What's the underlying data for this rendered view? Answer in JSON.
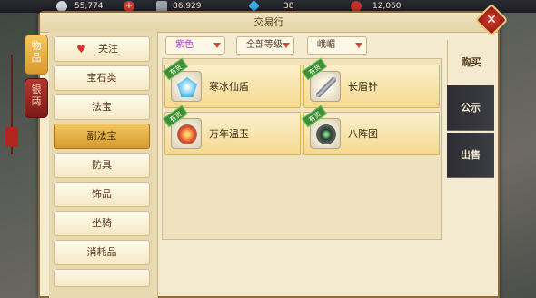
{
  "currency": [
    {
      "icon": "silver-ingot-icon",
      "value": "55,774"
    },
    {
      "icon": "add-icon",
      "value": ""
    },
    {
      "icon": "silver-chest-icon",
      "value": "86,929"
    },
    {
      "icon": "diamond-icon",
      "value": "38"
    },
    {
      "icon": "red-gem-icon",
      "value": "12,060"
    }
  ],
  "window": {
    "title": "交易行"
  },
  "left_tabs": [
    {
      "label": "物品",
      "active": true
    },
    {
      "label": "银两",
      "active": false
    }
  ],
  "categories": [
    {
      "label": "关注",
      "active": false
    },
    {
      "label": "宝石类",
      "active": false
    },
    {
      "label": "法宝",
      "active": false
    },
    {
      "label": "副法宝",
      "active": true
    },
    {
      "label": "防具",
      "active": false
    },
    {
      "label": "饰品",
      "active": false
    },
    {
      "label": "坐骑",
      "active": false
    },
    {
      "label": "消耗品",
      "active": false
    }
  ],
  "filters": {
    "quality": "紫色",
    "level": "全部等级",
    "server": "峨嵋"
  },
  "items": [
    {
      "name": "寒冰仙盾",
      "badge": "有货",
      "icon": "ice-shield-icon"
    },
    {
      "name": "长眉针",
      "badge": "有货",
      "icon": "needle-icon"
    },
    {
      "name": "万年温玉",
      "badge": "有货",
      "icon": "jade-lotus-icon"
    },
    {
      "name": "八阵图",
      "badge": "有货",
      "icon": "formation-disc-icon"
    }
  ],
  "right_tabs": [
    {
      "label": "购买",
      "active": true
    },
    {
      "label": "公示",
      "active": false
    },
    {
      "label": "出售",
      "active": false
    }
  ],
  "colors": {
    "accent_gold": "#d99a2e",
    "badge_green": "#3f8f35",
    "close_red": "#c0392b"
  }
}
